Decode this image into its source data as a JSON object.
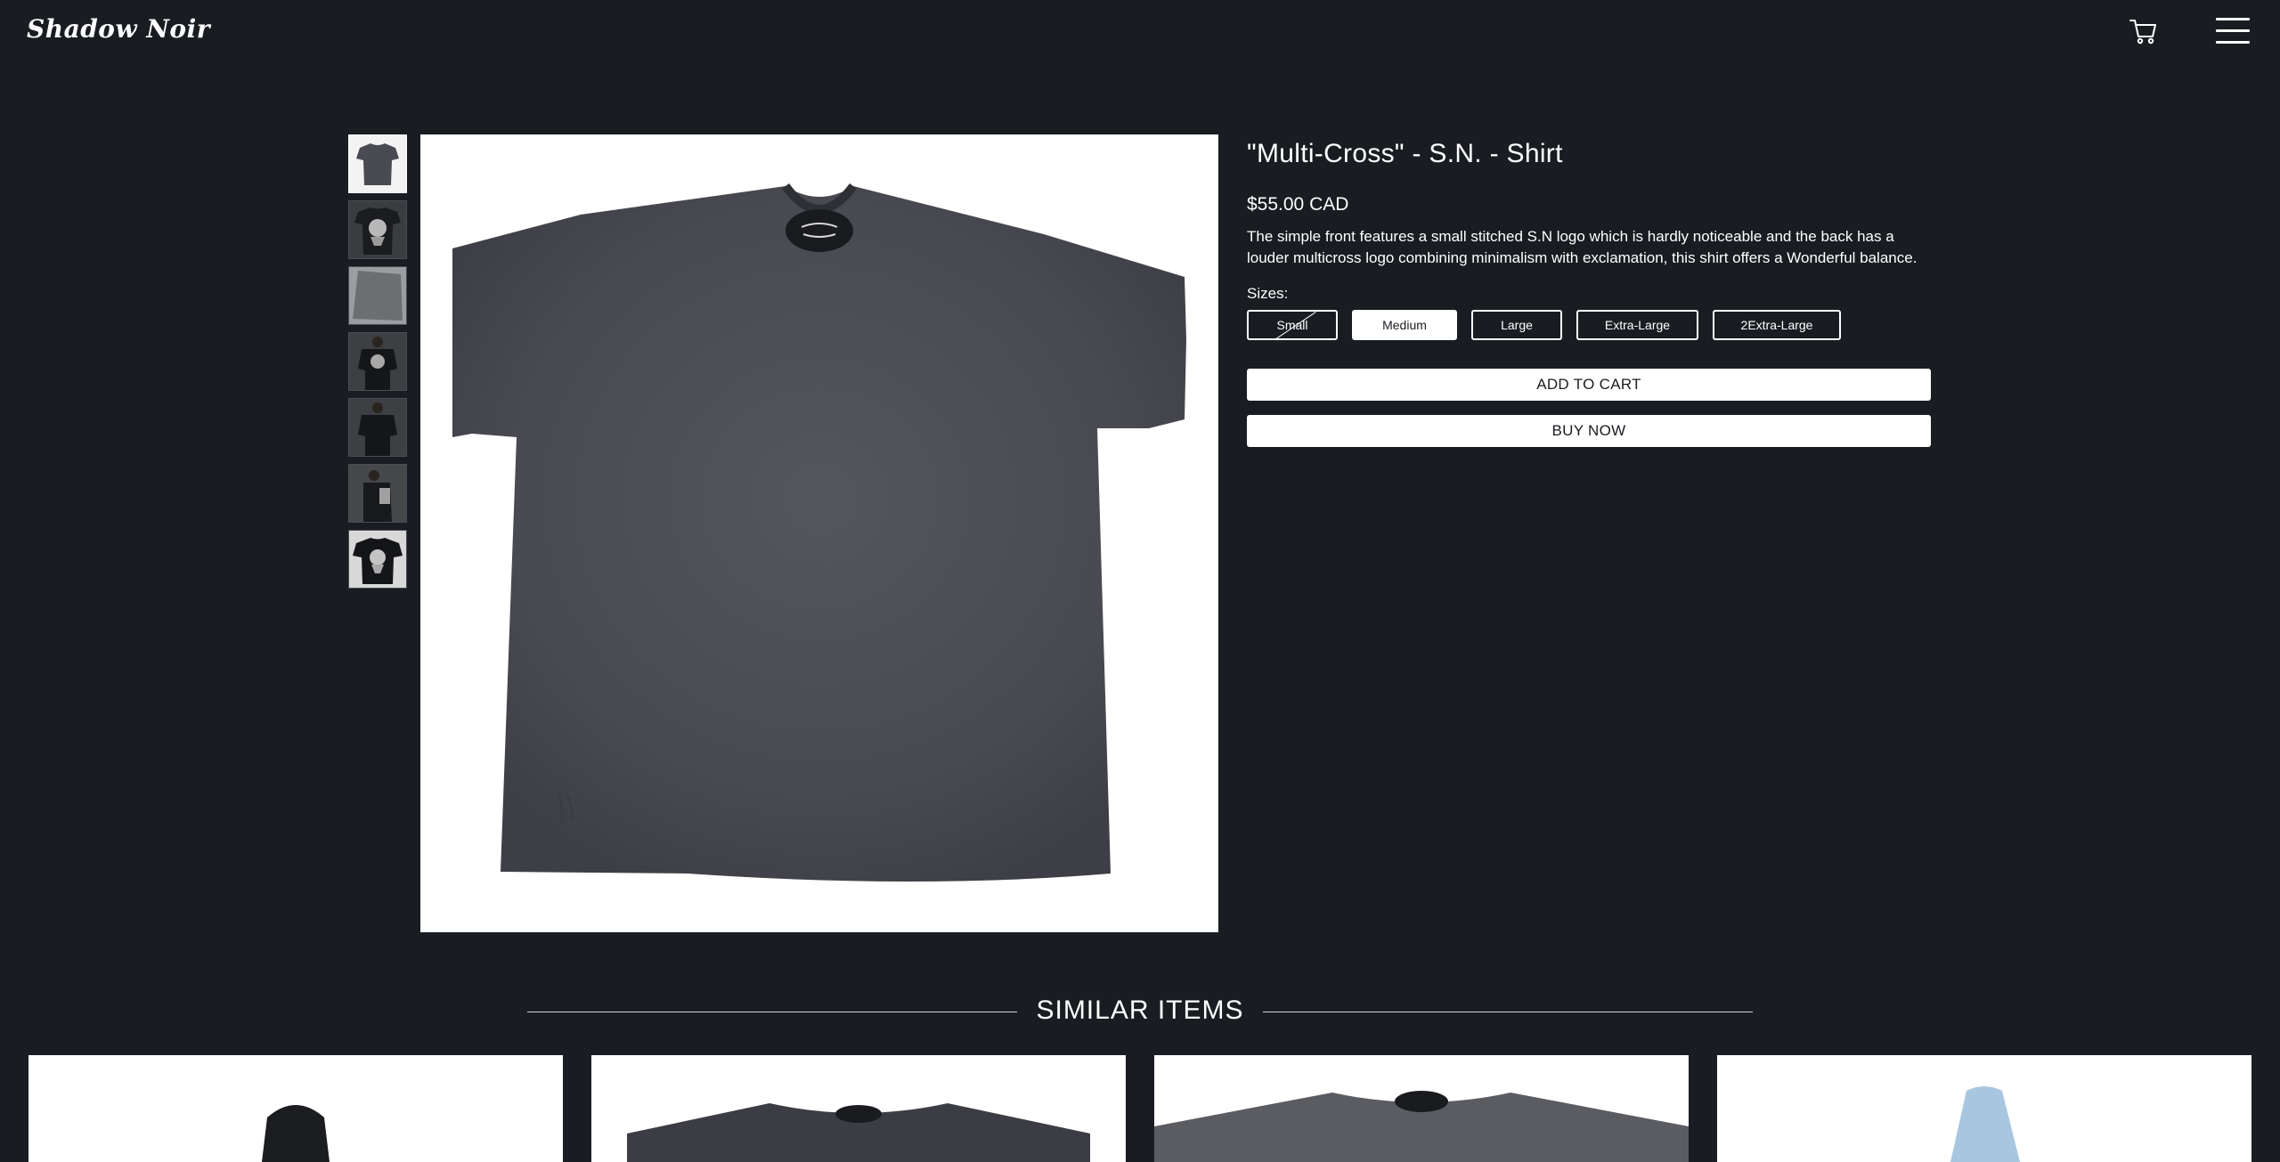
{
  "brand": {
    "name": "Shadow Noir"
  },
  "header": {
    "cart_icon": "cart-icon",
    "menu_icon": "hamburger-menu-icon"
  },
  "gallery": {
    "thumbnails": [
      {
        "alt": "shirt-front"
      },
      {
        "alt": "shirt-back"
      },
      {
        "alt": "fabric-detail"
      },
      {
        "alt": "model-back"
      },
      {
        "alt": "model-front"
      },
      {
        "alt": "model-side"
      },
      {
        "alt": "shirt-back-flat"
      }
    ],
    "selected_index": 0
  },
  "product": {
    "title": "\"Multi-Cross\" - S.N. - Shirt",
    "price": "$55.00 CAD",
    "description": "The simple front features a small stitched S.N logo which is hardly noticeable and the back has a louder multicross logo combining minimalism with exclamation, this shirt offers a Wonderful balance.",
    "sizes_label": "Sizes:",
    "sizes": [
      {
        "label": "Small",
        "state": "sold-out"
      },
      {
        "label": "Medium",
        "state": "selected"
      },
      {
        "label": "Large",
        "state": "available"
      },
      {
        "label": "Extra-Large",
        "state": "available"
      },
      {
        "label": "2Extra-Large",
        "state": "available"
      }
    ],
    "add_to_cart_label": "ADD TO CART",
    "buy_now_label": "BUY NOW"
  },
  "similar": {
    "title": "SIMILAR ITEMS",
    "items": [
      {
        "alt": "hoodie-black"
      },
      {
        "alt": "shirt-grey"
      },
      {
        "alt": "shirt-acid-wash"
      },
      {
        "alt": "hoodie-light-blue"
      }
    ]
  },
  "colors": {
    "background": "#191c21",
    "foreground": "#ffffff",
    "shirt": "#4a4b52"
  }
}
